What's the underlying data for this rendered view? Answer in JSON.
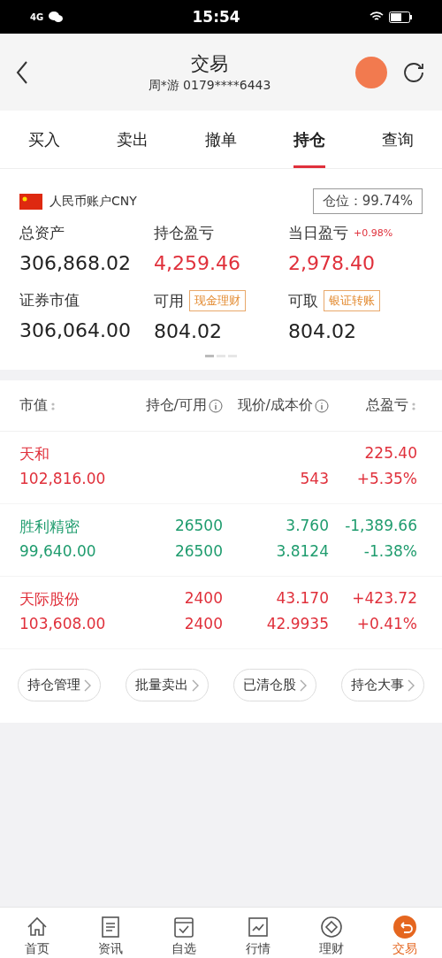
{
  "status_bar": {
    "network": "4G",
    "time": "15:54"
  },
  "header": {
    "title": "交易",
    "subtitle": "周*游 0179****6443"
  },
  "tabs": [
    {
      "label": "买入",
      "selected": false
    },
    {
      "label": "卖出",
      "selected": false
    },
    {
      "label": "撤单",
      "selected": false
    },
    {
      "label": "持仓",
      "selected": true
    },
    {
      "label": "查询",
      "selected": false
    }
  ],
  "account": {
    "name": "人民币账户CNY",
    "position": "仓位：99.74%",
    "stats": [
      {
        "label": "总资产",
        "value": "306,868.02",
        "color": "#222222"
      },
      {
        "label": "持仓盈亏",
        "value": "4,259.46",
        "color": "#e0303b"
      },
      {
        "label": "当日盈亏",
        "extra": "+0.98%",
        "value": "2,978.40",
        "color": "#e0303b"
      },
      {
        "label": "证券市值",
        "value": "306,064.00",
        "color": "#222222"
      },
      {
        "label": "可用",
        "action": "现金理财",
        "value": "804.02",
        "color": "#222222"
      },
      {
        "label": "可取",
        "action": "银证转账",
        "value": "804.02",
        "color": "#222222"
      }
    ],
    "pages": [
      {
        "selected": true
      },
      {
        "selected": false
      },
      {
        "selected": false
      }
    ]
  },
  "table": {
    "columns": [
      {
        "label": "市值",
        "kind": "sort"
      },
      {
        "label": "持仓/可用",
        "kind": "info"
      },
      {
        "label": "现价/成本价",
        "kind": "info"
      },
      {
        "label": "总盈亏",
        "kind": "sort"
      }
    ],
    "rows": [
      {
        "color": "#e0303b",
        "name": "天和",
        "market_value": "102,816.00",
        "cost": "543",
        "pnl": "225.40",
        "pnl_pct": "+5.35%"
      },
      {
        "color": "#1f9c6e",
        "name": "胜利精密",
        "market_value": "99,640.00",
        "hold": "26500",
        "avail": "26500",
        "price": "3.760",
        "cost": "3.8124",
        "pnl": "-1,389.66",
        "pnl_pct": "-1.38%"
      },
      {
        "color": "#e0303b",
        "name": "天际股份",
        "market_value": "103,608.00",
        "hold": "2400",
        "avail": "2400",
        "price": "43.170",
        "cost": "42.9935",
        "pnl": "+423.72",
        "pnl_pct": "+0.41%"
      }
    ]
  },
  "actions": [
    "持仓管理",
    "批量卖出",
    "已清仓股",
    "持仓大事"
  ],
  "bottom_nav": [
    {
      "label": "首页",
      "selected": false
    },
    {
      "label": "资讯",
      "selected": false
    },
    {
      "label": "自选",
      "selected": false
    },
    {
      "label": "行情",
      "selected": false
    },
    {
      "label": "理财",
      "selected": false
    },
    {
      "label": "交易",
      "selected": true
    }
  ]
}
